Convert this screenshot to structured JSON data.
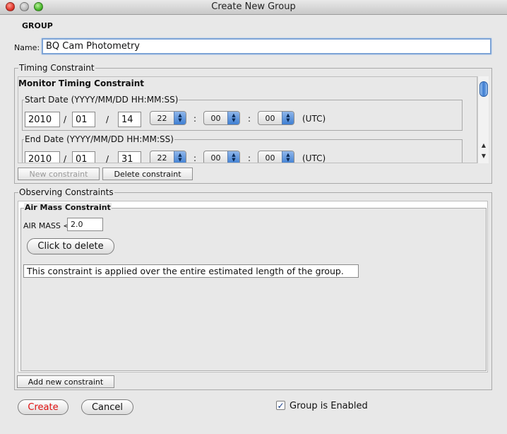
{
  "window": {
    "title": "Create New Group"
  },
  "group": {
    "heading": "GROUP",
    "name_label": "Name:",
    "name_value": "BQ Cam Photometry"
  },
  "timing": {
    "legend": "Timing Constraint",
    "constraint_title": "Monitor Timing Constraint",
    "start": {
      "legend": "Start Date (YYYY/MM/DD HH:MM:SS)",
      "year": "2010",
      "month": "01",
      "day": "14",
      "hour": "22",
      "minute": "00",
      "second": "00"
    },
    "end": {
      "legend": "End Date (YYYY/MM/DD HH:MM:SS)",
      "year": "2010",
      "month": "01",
      "day": "31",
      "hour": "22",
      "minute": "00",
      "second": "00"
    },
    "slash": "/",
    "colon": ":",
    "utc": "(UTC)",
    "new_button": "New constraint",
    "delete_button": "Delete constraint"
  },
  "observing": {
    "legend": "Observing Constraints",
    "airmass": {
      "legend": "Air Mass Constraint",
      "label": "AIR MASS <",
      "value": "2.0",
      "delete_button": "Click to delete",
      "note": "This constraint is applied over the entire estimated length of the group."
    },
    "add_button": "Add new constraint"
  },
  "footer": {
    "create": "Create",
    "cancel": "Cancel",
    "enabled_label": "Group is Enabled",
    "enabled_checked": true
  },
  "colors": {
    "create_text": "#e01010",
    "focus_border": "#7ea4d6"
  }
}
